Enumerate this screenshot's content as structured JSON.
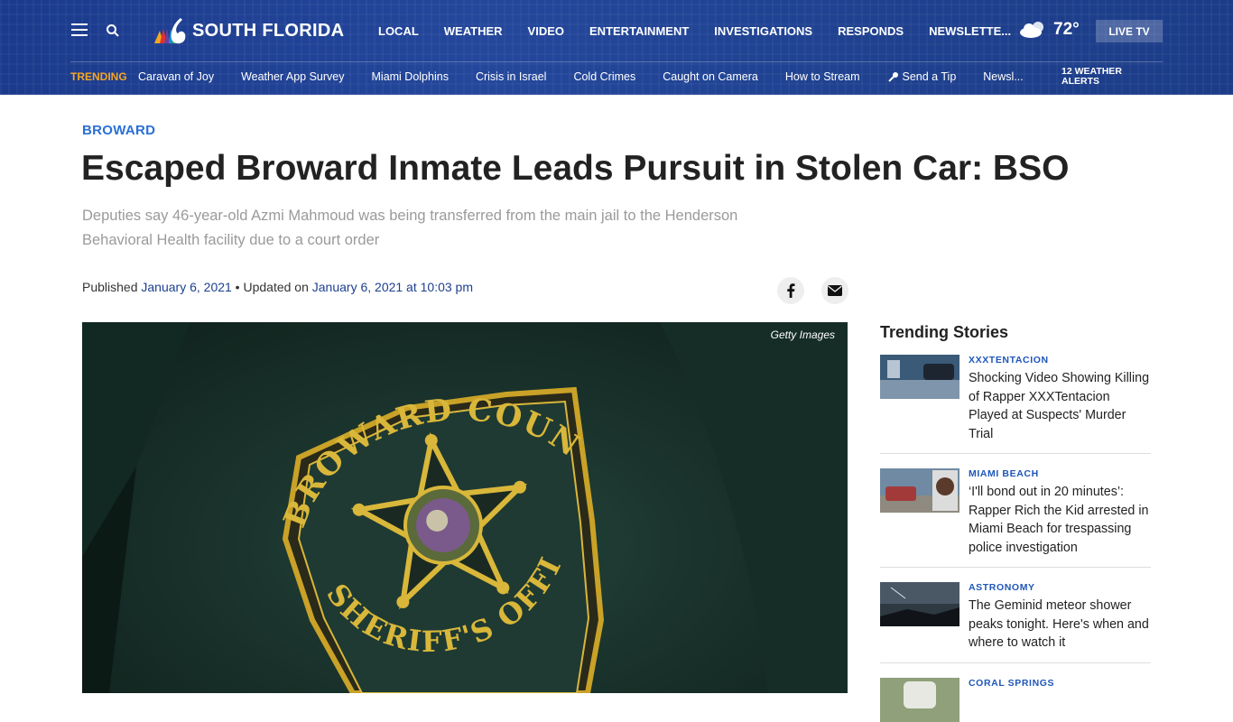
{
  "header": {
    "brand": "SOUTH FLORIDA",
    "nav": [
      "LOCAL",
      "WEATHER",
      "VIDEO",
      "ENTERTAINMENT",
      "INVESTIGATIONS",
      "RESPONDS",
      "NEWSLETTE..."
    ],
    "temperature": "72°",
    "live_tv": "LIVE TV",
    "weather_alerts_line1": "12 WEATHER",
    "weather_alerts_line2": "ALERTS"
  },
  "trending": {
    "label": "TRENDING",
    "links": [
      "Caravan of Joy",
      "Weather App Survey",
      "Miami Dolphins",
      "Crisis in Israel",
      "Cold Crimes",
      "Caught on Camera",
      "How to Stream",
      "Send a Tip",
      "Newsl..."
    ]
  },
  "article": {
    "category": "BROWARD",
    "headline": "Escaped Broward Inmate Leads Pursuit in Stolen Car: BSO",
    "dek": "Deputies say 46-year-old Azmi Mahmoud was being transferred from the main jail to the Henderson Behavioral Health facility due to a court order",
    "published_label": "Published ",
    "published_date": "January 6, 2021",
    "updated_label": " • Updated on ",
    "updated_date": "January 6, 2021 at 10:03 pm",
    "image_credit": "Getty Images",
    "badge_top": "BROWARD COUNTY",
    "badge_bottom": "SHERIFF'S OFFICE"
  },
  "sidebar": {
    "title": "Trending Stories",
    "stories": [
      {
        "kicker": "XXXTENTACION",
        "title": "Shocking Video Showing Killing of Rapper XXXTentacion Played at Suspects' Murder Trial"
      },
      {
        "kicker": "MIAMI BEACH",
        "title": "‘I'll bond out in 20 minutes’: Rapper Rich the Kid arrested in Miami Beach for trespassing police investigation"
      },
      {
        "kicker": "ASTRONOMY",
        "title": "The Geminid meteor shower peaks tonight. Here's when and where to watch it"
      },
      {
        "kicker": "CORAL SPRINGS",
        "title": ""
      }
    ]
  },
  "colors": {
    "header_bg": "#1f418f",
    "trending_accent": "#f5a623",
    "category_blue": "#2a6fd6",
    "date_blue": "#1d3f8f"
  }
}
